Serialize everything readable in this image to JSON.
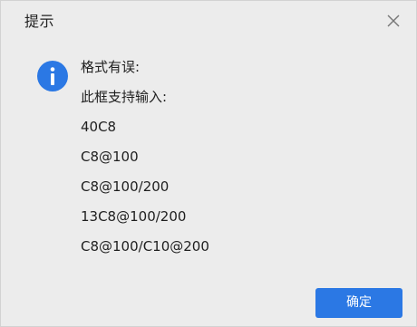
{
  "dialog": {
    "title": "提示",
    "close_icon": "close-icon",
    "icon": "info-icon",
    "accent_color": "#2b78e4",
    "message_lines": [
      "格式有误:",
      "此框支持输入:",
      "40C8",
      "C8@100",
      "C8@100/200",
      "13C8@100/200",
      "C8@100/C10@200"
    ],
    "ok_label": "确定"
  }
}
